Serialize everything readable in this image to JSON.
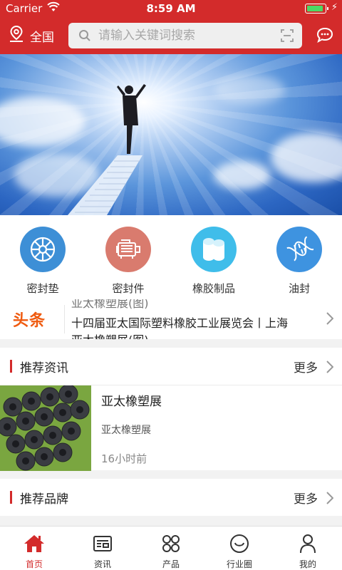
{
  "status_bar": {
    "carrier": "Carrier",
    "time": "8:59 AM",
    "battery_level": 0.95
  },
  "header": {
    "location_label": "全国",
    "search_placeholder": "请输入关键词搜索",
    "brand_color": "#d32b2b"
  },
  "categories": [
    {
      "label": "密封垫",
      "icon": "wheel-icon",
      "color": "#3d8fd6"
    },
    {
      "label": "密封件",
      "icon": "machine-icon",
      "color": "#d97b6e"
    },
    {
      "label": "橡胶制品",
      "icon": "rubber-rolls-icon",
      "color": "#3fbdea"
    },
    {
      "label": "油封",
      "icon": "dna-icon",
      "color": "#3e93e0"
    }
  ],
  "headline": {
    "logo": "头条",
    "items": [
      "亚太橡塑展(图)",
      "十四届亚太国际塑料橡胶工业展览会丨上海",
      "亚太橡塑展(图)"
    ]
  },
  "sections": {
    "recommended_news": {
      "title": "推荐资讯",
      "more": "更多"
    },
    "recommended_brands": {
      "title": "推荐品牌",
      "more": "更多"
    }
  },
  "news": [
    {
      "title": "亚太橡塑展",
      "source": "亚太橡塑展",
      "time": "16小时前"
    }
  ],
  "tabs": [
    {
      "label": "首页",
      "icon": "home-icon",
      "active": true
    },
    {
      "label": "资讯",
      "icon": "news-icon",
      "active": false
    },
    {
      "label": "产品",
      "icon": "product-grid-icon",
      "active": false
    },
    {
      "label": "行业圈",
      "icon": "smile-circle-icon",
      "active": false
    },
    {
      "label": "我的",
      "icon": "user-icon",
      "active": false
    }
  ]
}
